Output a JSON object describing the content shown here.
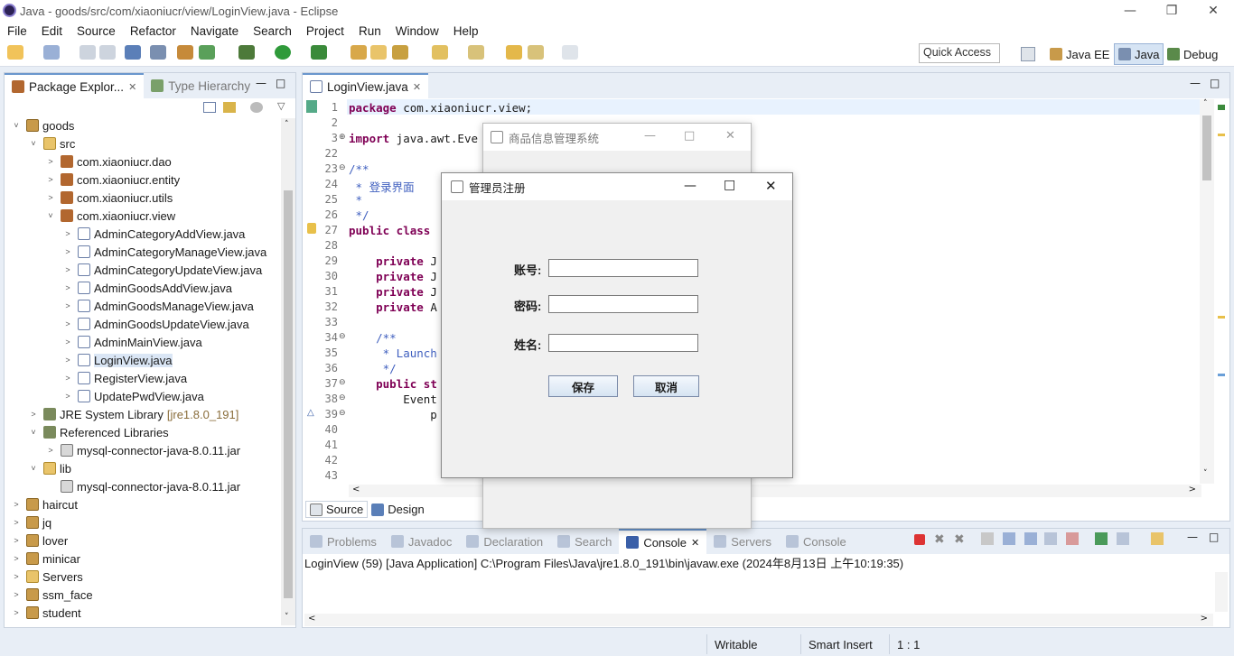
{
  "window": {
    "title": "Java - goods/src/com/xiaoniucr/view/LoginView.java - Eclipse"
  },
  "menu": [
    "File",
    "Edit",
    "Source",
    "Refactor",
    "Navigate",
    "Search",
    "Project",
    "Run",
    "Window",
    "Help"
  ],
  "toolbar": {
    "quick_access": "Quick Access"
  },
  "perspectives": [
    {
      "label": "Java EE"
    },
    {
      "label": "Java"
    },
    {
      "label": "Debug"
    }
  ],
  "explorer": {
    "tabs": [
      "Package Explor...",
      "Type Hierarchy"
    ],
    "tree": [
      {
        "label": "goods",
        "arrow": "˅",
        "icon": "proj",
        "level": 0
      },
      {
        "label": "src",
        "arrow": "˅",
        "icon": "folder",
        "level": 1
      },
      {
        "label": "com.xiaoniucr.dao",
        "arrow": ">",
        "icon": "pkg",
        "level": 2
      },
      {
        "label": "com.xiaoniucr.entity",
        "arrow": ">",
        "icon": "pkg",
        "level": 2
      },
      {
        "label": "com.xiaoniucr.utils",
        "arrow": ">",
        "icon": "pkg",
        "level": 2
      },
      {
        "label": "com.xiaoniucr.view",
        "arrow": "˅",
        "icon": "pkg",
        "level": 2
      },
      {
        "label": "AdminCategoryAddView.java",
        "arrow": ">",
        "icon": "java",
        "level": 3
      },
      {
        "label": "AdminCategoryManageView.java",
        "arrow": ">",
        "icon": "java",
        "level": 3
      },
      {
        "label": "AdminCategoryUpdateView.java",
        "arrow": ">",
        "icon": "java",
        "level": 3
      },
      {
        "label": "AdminGoodsAddView.java",
        "arrow": ">",
        "icon": "java",
        "level": 3
      },
      {
        "label": "AdminGoodsManageView.java",
        "arrow": ">",
        "icon": "java",
        "level": 3
      },
      {
        "label": "AdminGoodsUpdateView.java",
        "arrow": ">",
        "icon": "java",
        "level": 3
      },
      {
        "label": "AdminMainView.java",
        "arrow": ">",
        "icon": "java",
        "level": 3
      },
      {
        "label": "LoginView.java",
        "arrow": ">",
        "icon": "java",
        "level": 3,
        "selected": true
      },
      {
        "label": "RegisterView.java",
        "arrow": ">",
        "icon": "java",
        "level": 3
      },
      {
        "label": "UpdatePwdView.java",
        "arrow": ">",
        "icon": "java",
        "level": 3
      },
      {
        "label": "JRE System Library",
        "suffix": "[jre1.8.0_191]",
        "arrow": ">",
        "icon": "lib",
        "level": 1
      },
      {
        "label": "Referenced Libraries",
        "arrow": "˅",
        "icon": "lib",
        "level": 1
      },
      {
        "label": "mysql-connector-java-8.0.11.jar",
        "arrow": ">",
        "icon": "jar",
        "level": 2
      },
      {
        "label": "lib",
        "arrow": "˅",
        "icon": "folder",
        "level": 1
      },
      {
        "label": "mysql-connector-java-8.0.11.jar",
        "arrow": "",
        "icon": "jar",
        "level": 2
      },
      {
        "label": "haircut",
        "arrow": ">",
        "icon": "proj",
        "level": 0
      },
      {
        "label": "jq",
        "arrow": ">",
        "icon": "proj",
        "level": 0
      },
      {
        "label": "lover",
        "arrow": ">",
        "icon": "proj",
        "level": 0
      },
      {
        "label": "minicar",
        "arrow": ">",
        "icon": "proj",
        "level": 0
      },
      {
        "label": "Servers",
        "arrow": ">",
        "icon": "folder",
        "level": 0
      },
      {
        "label": "ssm_face",
        "arrow": ">",
        "icon": "proj",
        "level": 0
      },
      {
        "label": "student",
        "arrow": ">",
        "icon": "proj",
        "level": 0
      }
    ]
  },
  "editor": {
    "tab": "LoginView.java",
    "lines": [
      {
        "n": "1",
        "fold": "",
        "html": "<span class='kw'>package</span> com.xiaoniucr.view;"
      },
      {
        "n": "2",
        "fold": "",
        "html": ""
      },
      {
        "n": "3",
        "fold": "⊕",
        "html": "<span class='kw'>import</span> java.awt.Eve"
      },
      {
        "n": "22",
        "fold": "",
        "html": ""
      },
      {
        "n": "23",
        "fold": "⊖",
        "html": "<span class='cm'>/**</span>"
      },
      {
        "n": "24",
        "fold": "",
        "html": "<span class='cm'> * 登录界面</span>"
      },
      {
        "n": "25",
        "fold": "",
        "html": "<span class='cm'> *</span>"
      },
      {
        "n": "26",
        "fold": "",
        "html": "<span class='cm'> */</span>"
      },
      {
        "n": "27",
        "fold": "",
        "html": "<span class='kw'>public class</span>"
      },
      {
        "n": "28",
        "fold": "",
        "html": ""
      },
      {
        "n": "29",
        "fold": "",
        "html": "    <span class='kw'>private</span> J"
      },
      {
        "n": "30",
        "fold": "",
        "html": "    <span class='kw'>private</span> J"
      },
      {
        "n": "31",
        "fold": "",
        "html": "    <span class='kw'>private</span> J"
      },
      {
        "n": "32",
        "fold": "",
        "html": "    <span class='kw'>private</span> A"
      },
      {
        "n": "33",
        "fold": "",
        "html": ""
      },
      {
        "n": "34",
        "fold": "⊖",
        "html": "    <span class='cm'>/**</span>"
      },
      {
        "n": "35",
        "fold": "",
        "html": "<span class='cm'>     * Launch</span>"
      },
      {
        "n": "36",
        "fold": "",
        "html": "<span class='cm'>     */</span>"
      },
      {
        "n": "37",
        "fold": "⊖",
        "html": "    <span class='kw'>public</span> <span class='kw'>st</span>"
      },
      {
        "n": "38",
        "fold": "⊖",
        "html": "        Event"
      },
      {
        "n": "39",
        "fold": "⊖",
        "html": "            p"
      },
      {
        "n": "40",
        "fold": "",
        "html": ""
      },
      {
        "n": "41",
        "fold": "",
        "html": ""
      },
      {
        "n": "42",
        "fold": "",
        "html": ""
      },
      {
        "n": "43",
        "fold": "",
        "html": ""
      }
    ],
    "bottom_tabs": [
      "Source",
      "Design"
    ]
  },
  "console": {
    "tabs": [
      "Problems",
      "Javadoc",
      "Declaration",
      "Search",
      "Console",
      "Servers",
      "Console"
    ],
    "info": "LoginView (59) [Java Application] C:\\Program Files\\Java\\jre1.8.0_191\\bin\\javaw.exe (2024年8月13日 上午10:19:35)"
  },
  "bg_window": {
    "title": "商品信息管理系统"
  },
  "dialog": {
    "title": "管理员注册",
    "fields": [
      {
        "label": "账号:",
        "value": ""
      },
      {
        "label": "密码:",
        "value": ""
      },
      {
        "label": "姓名:",
        "value": ""
      }
    ],
    "save": "保存",
    "cancel": "取消"
  },
  "status": {
    "writable": "Writable",
    "insert": "Smart Insert",
    "pos": "1 : 1"
  }
}
